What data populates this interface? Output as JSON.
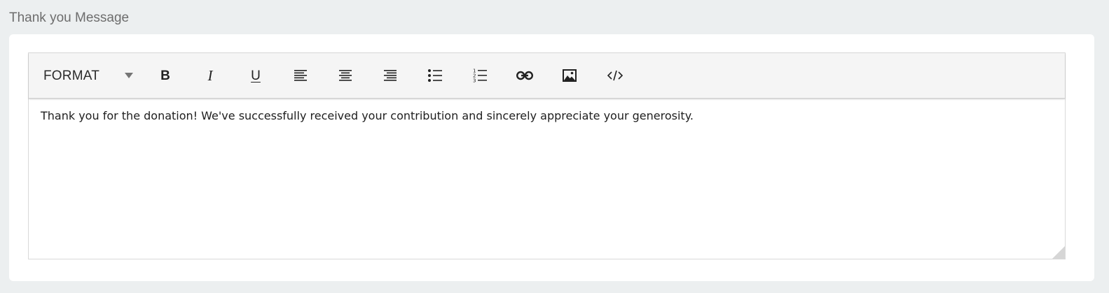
{
  "section": {
    "label": "Thank you Message"
  },
  "toolbar": {
    "format_label": "FORMAT",
    "bold_glyph": "B",
    "italic_glyph": "I",
    "underline_glyph": "U",
    "icons": [
      "bold-icon",
      "italic-icon",
      "underline-icon",
      "align-left-icon",
      "align-center-icon",
      "align-right-icon",
      "bulleted-list-icon",
      "numbered-list-icon",
      "link-icon",
      "image-icon",
      "code-icon"
    ]
  },
  "editor": {
    "content": "Thank you for the donation! We've successfully received your contribution and sincerely appreciate your generosity."
  },
  "colors": {
    "page_background": "#eceff0",
    "card_background": "#ffffff",
    "toolbar_background": "#f5f5f5",
    "label_text": "#6d6d6d",
    "icon": "#222222"
  }
}
